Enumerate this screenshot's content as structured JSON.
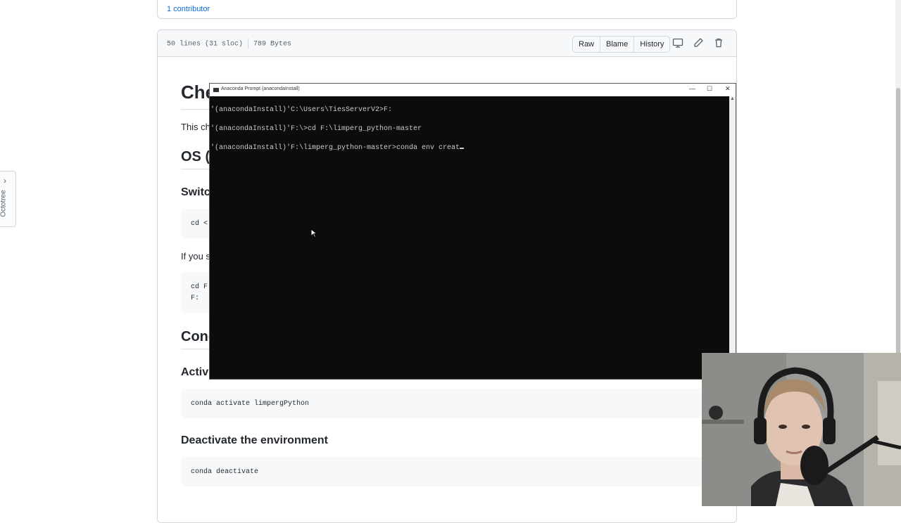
{
  "contributors": {
    "label": "1 contributor"
  },
  "file_header": {
    "lines": "50 lines (31 sloc)",
    "size": "789 Bytes",
    "buttons": [
      "Raw",
      "Blame",
      "History"
    ],
    "icons": [
      "desktop-icon",
      "pencil-icon",
      "trash-icon"
    ]
  },
  "sidebar": {
    "octotree_label": "Octotree"
  },
  "readme": {
    "title_partial": "Che",
    "intro_partial": "This ch",
    "os_heading_partial": "OS (",
    "switch_heading_partial": "Switc",
    "code1_partial": "cd <",
    "if_partial": "If you s",
    "code2_line1": "cd F",
    "code2_line2": "F:",
    "conda_heading_partial": "Cond",
    "activate_heading_partial": "Activ",
    "activate_code": "conda activate limpergPython",
    "deactivate_heading": "Deactivate the environment",
    "deactivate_code": "conda deactivate"
  },
  "terminal": {
    "title": "Anaconda Prompt (anacondaInstall)",
    "lines": [
      "'(anacondaInstall)'C:\\Users\\TiesServerV2>F:",
      "'(anacondaInstall)'F:\\>cd F:\\limperg_python-master",
      "'(anacondaInstall)'F:\\limperg_python-master>conda env creat"
    ],
    "controls": {
      "minimize": "—",
      "maximize": "☐",
      "close": "✕"
    }
  },
  "colors": {
    "link": "#0969da",
    "terminal_bg": "#0c0c0c",
    "terminal_fg": "#cccccc"
  }
}
